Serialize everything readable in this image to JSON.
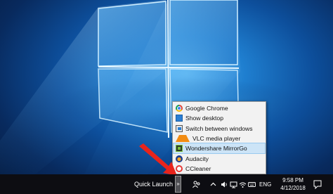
{
  "desktop": {
    "wallpaper": "windows-10-hero",
    "colors": {
      "accent": "#1f7fd0",
      "dark": "#051a3d",
      "glow": "#a8dcff"
    }
  },
  "quick_launch_menu": {
    "items": [
      {
        "label": "Google Chrome",
        "icon": "chrome-icon"
      },
      {
        "label": "Show desktop",
        "icon": "show-desktop-icon"
      },
      {
        "label": "Switch between windows",
        "icon": "switch-windows-icon"
      },
      {
        "label": "VLC media player",
        "icon": "vlc-icon"
      },
      {
        "label": "Wondershare MirrorGo",
        "icon": "mirrorgo-icon",
        "highlighted": true
      },
      {
        "label": "Audacity",
        "icon": "audacity-icon"
      },
      {
        "label": "CCleaner",
        "icon": "ccleaner-icon"
      }
    ]
  },
  "taskbar": {
    "toolbar_label": "Quick Launch",
    "toolbar_chevron": "»",
    "tray": {
      "icons": [
        "people-icon",
        "chevron-up-icon",
        "volume-icon",
        "network-icon",
        "wifi-icon",
        "keyboard-icon"
      ],
      "language": "ENG",
      "time": "9:58 PM",
      "date": "4/12/2018"
    }
  },
  "annotation": {
    "arrow_color": "#e8241c"
  }
}
